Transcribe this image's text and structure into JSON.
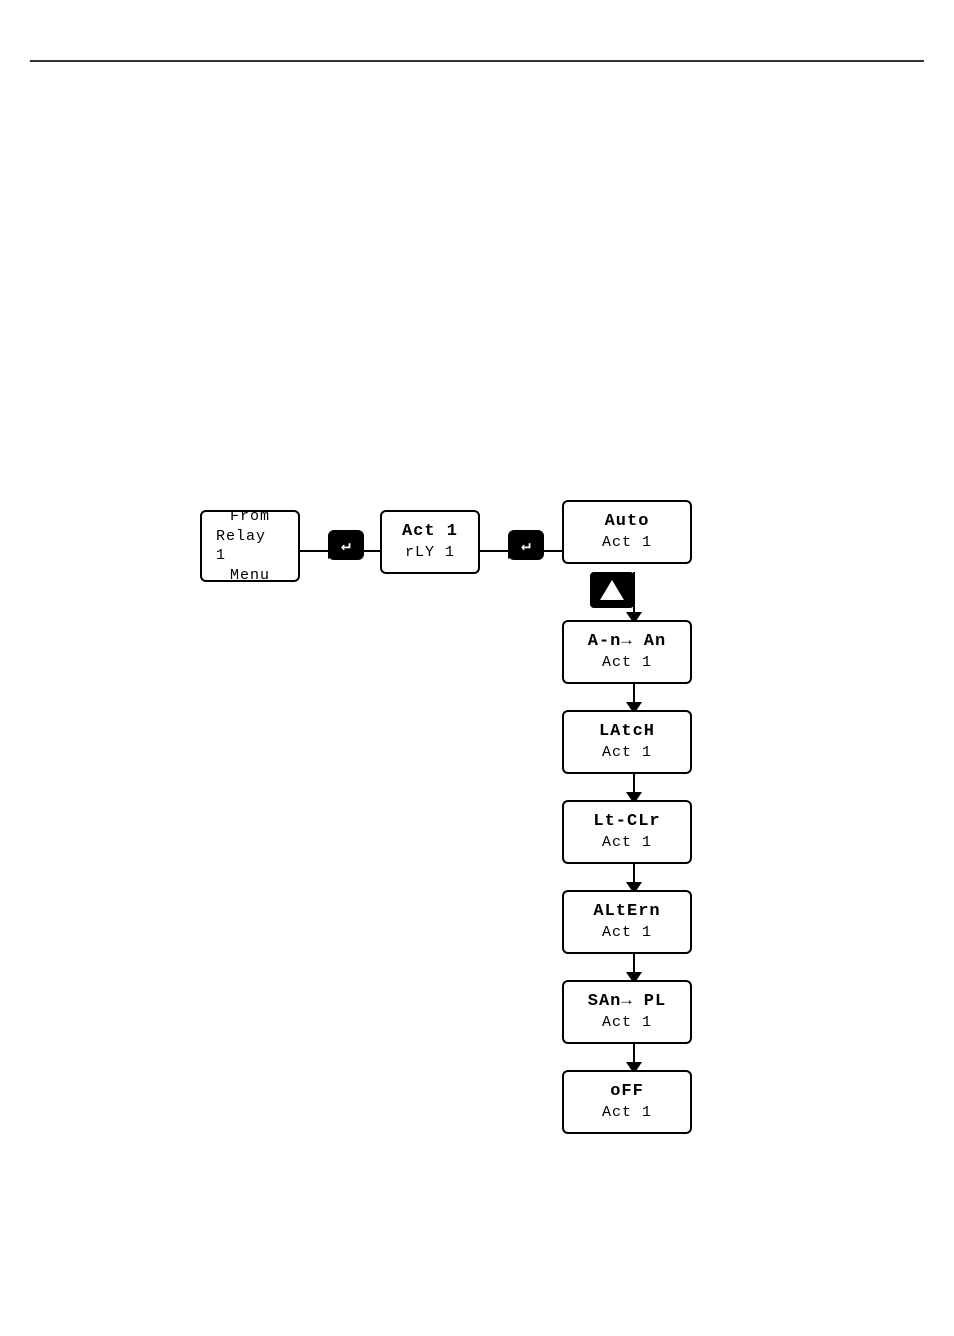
{
  "diagram": {
    "from_relay_menu": {
      "line1": "From",
      "line2": "Relay 1",
      "line3": "Menu"
    },
    "act_rly": {
      "line1": "Act  1",
      "line2": "rLY 1"
    },
    "boxes": [
      {
        "id": "auto",
        "line1": "Auto",
        "line2": "Act  1"
      },
      {
        "id": "a-no-an",
        "line1": "A-n→ An",
        "line2": "Act  1"
      },
      {
        "id": "latch",
        "line1": "LAtcH",
        "line2": "Act  1"
      },
      {
        "id": "lt-clr",
        "line1": "Lt-CLr",
        "line2": "Act  1"
      },
      {
        "id": "altern",
        "line1": "ALtErn",
        "line2": "Act  1"
      },
      {
        "id": "samp-pl",
        "line1": "SAn→ PL",
        "line2": "Act  1"
      },
      {
        "id": "off",
        "line1": "oFF",
        "line2": "Act  1"
      }
    ],
    "enter_label": "↵"
  }
}
